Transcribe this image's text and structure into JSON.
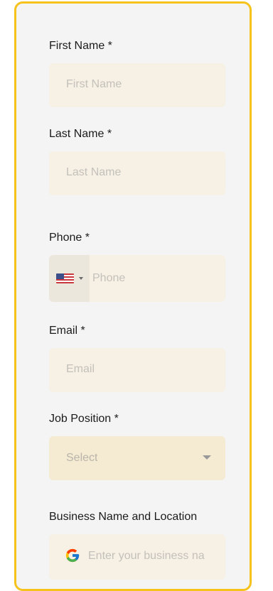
{
  "form": {
    "first_name": {
      "label": "First Name *",
      "placeholder": "First Name"
    },
    "last_name": {
      "label": "Last Name *",
      "placeholder": "Last Name"
    },
    "phone": {
      "label": "Phone *",
      "placeholder": "Phone",
      "country_flag_icon": "us-flag-icon"
    },
    "email": {
      "label": "Email *",
      "placeholder": "Email"
    },
    "job_position": {
      "label": "Job Position *",
      "selected": "Select"
    },
    "business": {
      "label": "Business Name and Location",
      "placeholder": "Enter your business na",
      "icon": "google-g-icon"
    }
  },
  "colors": {
    "border_accent": "#f6c21c",
    "card_background": "#f4f4f5",
    "input_background": "#f7f0e4",
    "placeholder_text": "#c3c1bb"
  }
}
